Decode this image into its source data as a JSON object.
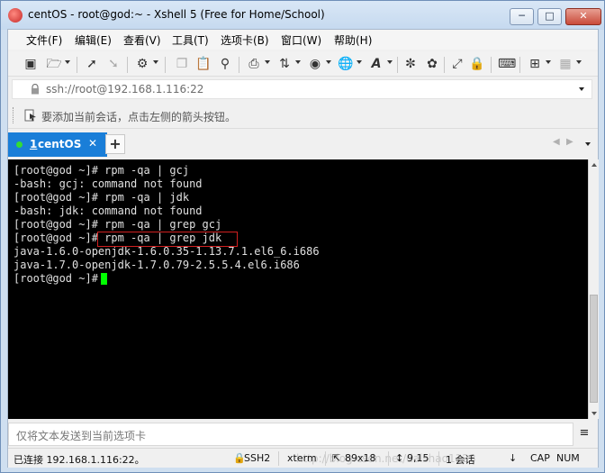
{
  "window": {
    "title": "centOS - root@god:~ - Xshell 5 (Free for Home/School)",
    "buttons": {
      "minimize": "─",
      "maximize": "□",
      "close": "✕"
    }
  },
  "menu": {
    "items": [
      "文件(F)",
      "编辑(E)",
      "查看(V)",
      "工具(T)",
      "选项卡(B)",
      "窗口(W)",
      "帮助(H)"
    ]
  },
  "toolbar": {
    "icons": [
      "new-session-icon",
      "open-folder-icon",
      "connect-icon",
      "disconnect-icon",
      "properties-icon",
      "copy-icon",
      "paste-icon",
      "find-icon",
      "print-icon",
      "transfer-icon",
      "color-scheme-icon",
      "globe-icon",
      "font-icon",
      "xftp-icon",
      "xmanager-icon",
      "fullscreen-icon",
      "lock-icon",
      "keyboard-icon",
      "add-icon",
      "layout-icon"
    ]
  },
  "address": {
    "value": "ssh://root@192.168.1.116:22"
  },
  "hint": {
    "text": "要添加当前会话，点击左侧的箭头按钮。"
  },
  "tabs": {
    "active_number": "1",
    "active_label": "centOS",
    "close": "✕",
    "add": "+",
    "prev": "◀",
    "next": "▶"
  },
  "terminal": {
    "lines": [
      "[root@god ~]# rpm -qa | gcj",
      "-bash: gcj: command not found",
      "[root@god ~]# rpm -qa | jdk",
      "-bash: jdk: command not found",
      "[root@god ~]# rpm -qa | grep gcj",
      "[root@god ~]# rpm -qa | grep jdk",
      "java-1.6.0-openjdk-1.6.0.35-1.13.7.1.el6_6.i686",
      "java-1.7.0-openjdk-1.7.0.79-2.5.5.4.el6.i686",
      "[root@god ~]# "
    ],
    "cursor_color": "#00ff00",
    "highlight_color": "#d02020"
  },
  "compose": {
    "placeholder": "仅将文本发送到当前选项卡",
    "menu": "≡"
  },
  "status": {
    "connection": "已连接 192.168.1.116:22。",
    "protocol": "SSH2",
    "terminal_type": "xterm",
    "size": "89x18",
    "position": "9,15",
    "sessions": "1 会话",
    "caps": "CAP",
    "num": "NUM",
    "watermark": "http://blog.csdn.net/dalshao1128"
  }
}
